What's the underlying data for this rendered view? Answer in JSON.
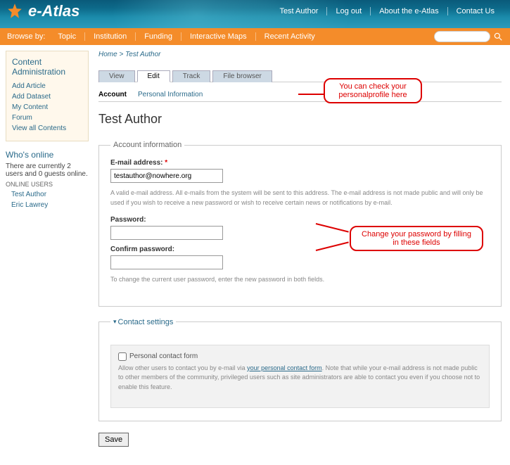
{
  "site": {
    "name": "e-Atlas"
  },
  "top_links": [
    {
      "label": "Test Author"
    },
    {
      "label": "Log out"
    },
    {
      "label": "About the e-Atlas"
    },
    {
      "label": "Contact Us"
    }
  ],
  "nav": {
    "label": "Browse by:",
    "items": [
      "Topic",
      "Institution",
      "Funding",
      "Interactive Maps",
      "Recent Activity"
    ]
  },
  "search": {
    "placeholder": ""
  },
  "sidebar": {
    "admin": {
      "title": "Content Administration",
      "links": [
        "Add Article",
        "Add Dataset",
        "My Content",
        "Forum",
        "View all Contents"
      ]
    },
    "online": {
      "title": "Who's online",
      "text": "There are currently 2 users and 0 guests online.",
      "caption": "ONLINE USERS",
      "users": [
        "Test Author",
        "Eric Lawrey"
      ]
    }
  },
  "crumbs": {
    "home": "Home",
    "sep": ">",
    "current": "Test Author"
  },
  "tabs1": [
    {
      "label": "View"
    },
    {
      "label": "Edit",
      "active": true
    },
    {
      "label": "Track"
    },
    {
      "label": "File browser"
    }
  ],
  "tabs2": [
    {
      "label": "Account",
      "active": true
    },
    {
      "label": "Personal Information"
    }
  ],
  "page_title": "Test Author",
  "callouts": {
    "profile": "You can check your personalprofile here",
    "password": "Change your password by filling in these fields"
  },
  "account": {
    "legend": "Account information",
    "email_label": "E-mail address:",
    "email_value": "testauthor@nowhere.org",
    "email_help": "A valid e-mail address. All e-mails from the system will be sent to this address. The e-mail address is not made public and will only be used if you wish to receive a new password or wish to receive certain news or notifications by e-mail.",
    "pw_label": "Password:",
    "pw2_label": "Confirm password:",
    "pw_help": "To change the current user password, enter the new password in both fields."
  },
  "contact": {
    "legend": "Contact settings",
    "checkbox_label": "Personal contact form",
    "help_pre": "Allow other users to contact you by e-mail via ",
    "help_link": "your personal contact form",
    "help_post": ". Note that while your e-mail address is not made public to other members of the community, privileged users such as site administrators are able to contact you even if you choose not to enable this feature."
  },
  "save": "Save"
}
